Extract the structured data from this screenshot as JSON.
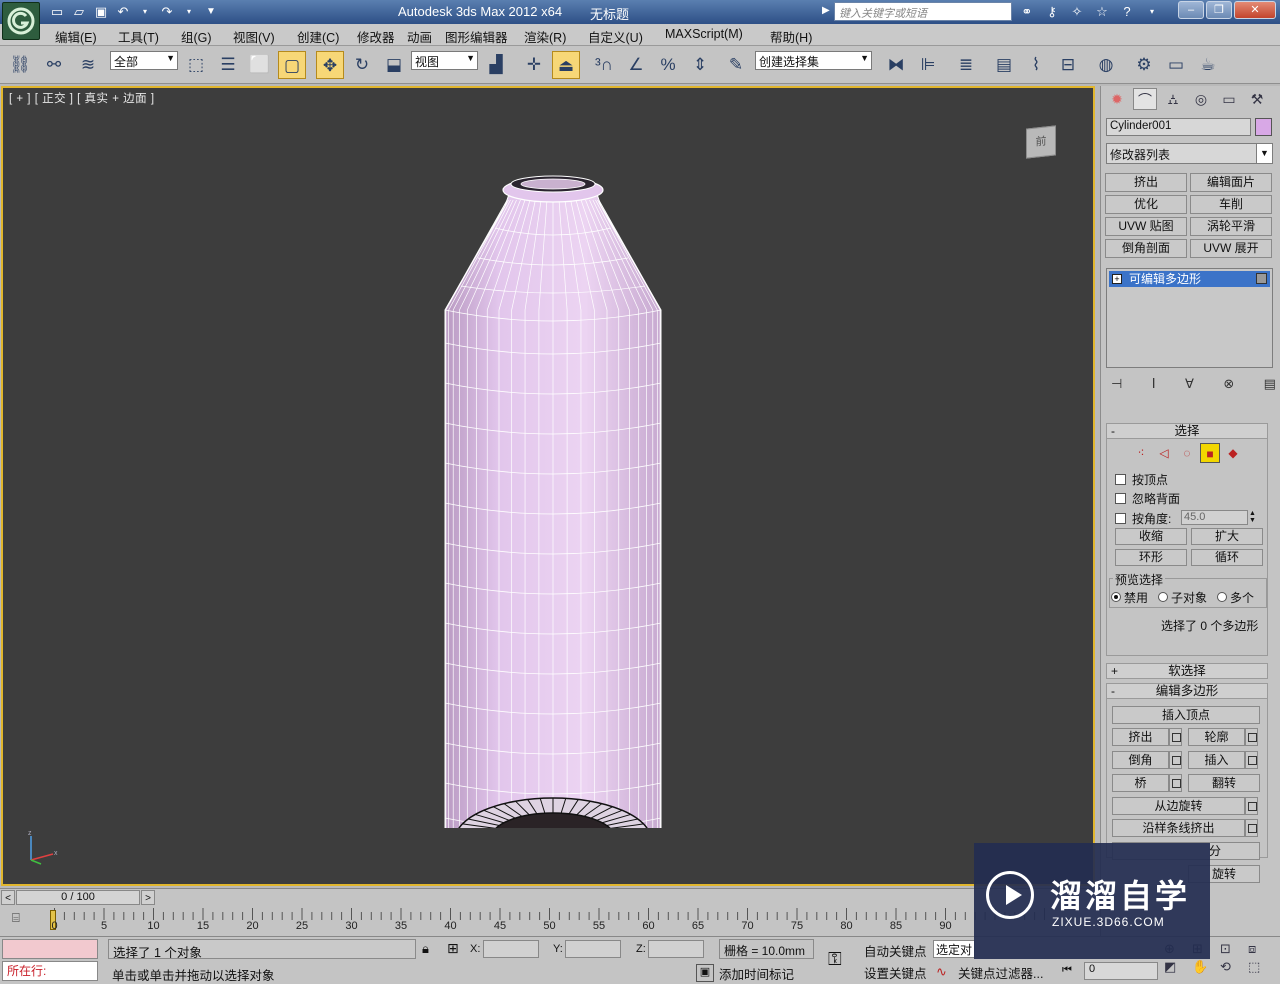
{
  "window": {
    "title": "Autodesk 3ds Max  2012 x64",
    "file": "无标题",
    "search_placeholder": "键入关键字或短语"
  },
  "menu": [
    "编辑(E)",
    "工具(T)",
    "组(G)",
    "视图(V)",
    "创建(C)",
    "修改器",
    "动画",
    "图形编辑器",
    "渲染(R)",
    "自定义(U)",
    "MAXScript(M)",
    "帮助(H)"
  ],
  "toolbar": {
    "filter_value": "全部",
    "coord_value": "视图",
    "named_sel_value": "创建选择集"
  },
  "viewport": {
    "label": "[ + ] [ 正交 ] [ 真实 + 边面 ]",
    "viewcube_face": "前",
    "object_color": "#e2c6ec",
    "edge_color": "#ffffff"
  },
  "command_panel": {
    "object_name": "Cylinder001",
    "object_color": "#d8a8e6",
    "modifier_list": "修改器列表",
    "modifier_buttons": [
      "挤出",
      "编辑面片",
      "优化",
      "车削",
      "UVW 贴图",
      "涡轮平滑",
      "倒角剖面",
      "UVW 展开"
    ],
    "stack_item": "可编辑多边形",
    "selection": {
      "title": "选择",
      "by_vertex": "按顶点",
      "ignore_backfacing": "忽略背面",
      "by_angle": "按角度:",
      "angle_value": "45.0",
      "shrink": "收缩",
      "grow": "扩大",
      "ring": "环形",
      "loop": "循环",
      "preview_label": "预览选择",
      "preview_off": "禁用",
      "preview_subobj": "子对象",
      "preview_multi": "多个",
      "status": "选择了 0 个多边形"
    },
    "soft_selection": "软选择",
    "edit_poly": {
      "title": "编辑多边形",
      "insert_vertex": "插入顶点",
      "extrude": "挤出",
      "outline": "轮廓",
      "bevel": "倒角",
      "inset": "插入",
      "bridge": "桥",
      "flip": "翻转",
      "hinge": "从边旋转",
      "extrude_along_spline": "沿样条线挤出",
      "partial_1": "分",
      "partial_2": "旋转"
    }
  },
  "time": {
    "slider": "0 / 100",
    "ticks": [
      "0",
      "5",
      "10",
      "15",
      "20",
      "25",
      "30",
      "35",
      "40",
      "45",
      "50",
      "55",
      "60",
      "65",
      "70",
      "75",
      "80",
      "85",
      "90"
    ]
  },
  "status": {
    "mxs_label": "所在行:",
    "selection": "选择了 1 个对象",
    "prompt": "单击或单击并拖动以选择对象",
    "x_label": "X:",
    "y_label": "Y:",
    "z_label": "Z:",
    "grid": "栅格 = 10.0mm",
    "add_time_tag": "添加时间标记",
    "auto_key": "自动关键点",
    "set_key": "设置关键点",
    "selected": "选定对",
    "key_filters": "关键点过滤器...",
    "frame": "0"
  },
  "watermark": {
    "title": "溜溜自学",
    "subtitle": "ZIXUE.3D66.COM"
  }
}
